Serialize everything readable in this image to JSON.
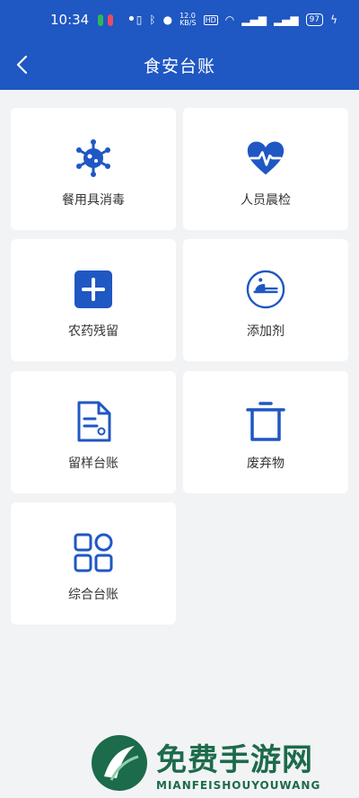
{
  "status_bar": {
    "time": "10:34",
    "network_speed": "12.0",
    "network_speed_unit": "KB/S",
    "hd_label": "HD",
    "battery": "97"
  },
  "header": {
    "title": "食安台账",
    "back_icon": "chevron-left-icon"
  },
  "grid": {
    "items": [
      {
        "label": "餐用具消毒",
        "icon": "virus-icon"
      },
      {
        "label": "人员晨检",
        "icon": "heart-pulse-icon"
      },
      {
        "label": "农药残留",
        "icon": "plus-square-icon"
      },
      {
        "label": "添加剂",
        "icon": "seasoning-spoon-icon"
      },
      {
        "label": "留样台账",
        "icon": "document-icon"
      },
      {
        "label": "废弃物",
        "icon": "trash-icon"
      },
      {
        "label": "综合台账",
        "icon": "grid-icon"
      }
    ]
  },
  "watermark": {
    "cn": "免费手游网",
    "en": "MIANFEISHOUYOUWANG"
  },
  "colors": {
    "primary": "#1f57c3",
    "background": "#f2f3f5",
    "card": "#ffffff",
    "watermark": "#1c6b4a"
  }
}
